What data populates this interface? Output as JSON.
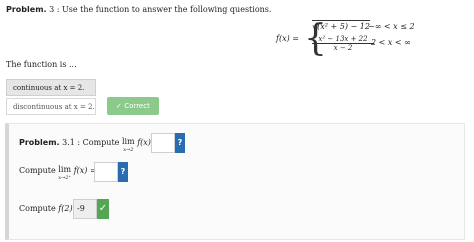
{
  "problem": {
    "label": "Problem.",
    "number": "3",
    "instruction": ": Use the function to answer the following questions."
  },
  "function": {
    "lhs": "f(x) =",
    "case1_expr": "√(x² + 5) − 12",
    "case1_cond": "−∞ < x ≤ 2",
    "case2_numerator": "x² − 13x + 22",
    "case2_denominator": "x − 2",
    "case2_cond": "2 < x < ∞"
  },
  "question": {
    "prompt": "The function is ..."
  },
  "choices": [
    {
      "label": "continuous at x = 2.",
      "selected": true
    },
    {
      "label": "discontinuous at x = 2.",
      "selected": false
    }
  ],
  "feedback": {
    "correct_label": "Correct",
    "check_icon": "check-icon"
  },
  "subproblems": [
    {
      "label": "Problem.",
      "number": "3.1",
      "prefix": ": Compute",
      "lim_word": "lim",
      "lim_sub": "x→2",
      "expr": "f(x) =",
      "value": "",
      "button": "?"
    },
    {
      "prefix": "Compute",
      "lim_word": "lim",
      "lim_sub": "x→2⁺",
      "expr": "f(x) =",
      "value": "",
      "button": "?"
    },
    {
      "prefix": "Compute",
      "expr": "f(2) =",
      "value": "-9",
      "button": "✓"
    }
  ],
  "colors": {
    "correct_green": "#8cca8c",
    "help_blue": "#2b6cb0",
    "check_green": "#53a653"
  }
}
